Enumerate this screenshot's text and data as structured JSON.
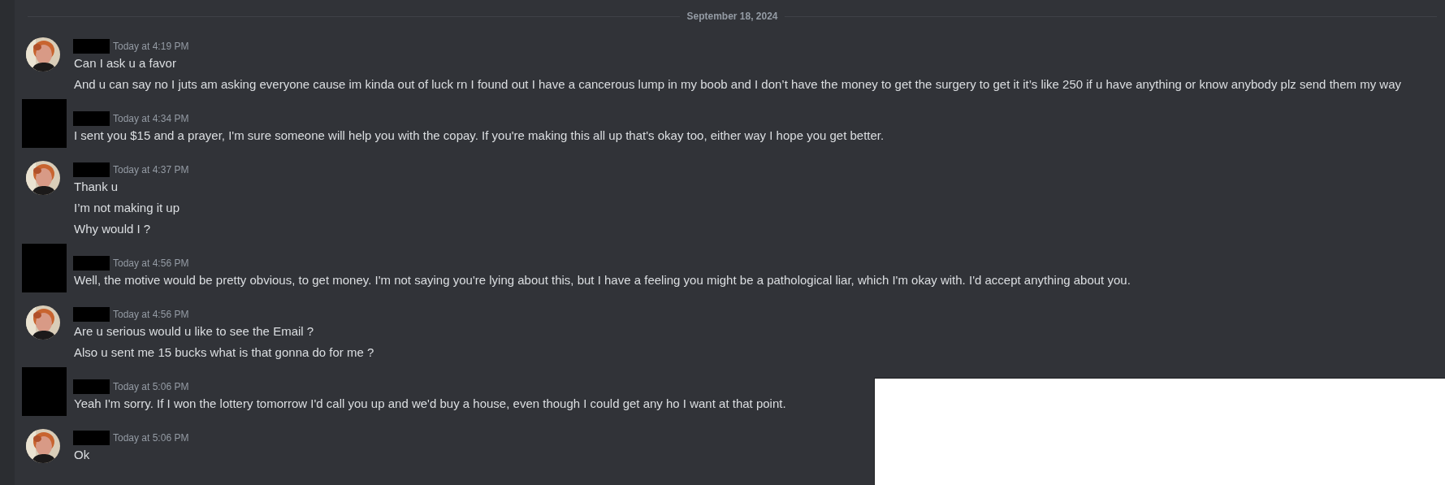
{
  "date_divider": "September 18, 2024",
  "messages": [
    {
      "time": "Today at 4:19 PM",
      "lines": [
        "Can I ask u a favor",
        "And u can say no I juts am asking everyone cause im kinda out of luck rn I found out I have a cancerous lump in my boob  and I don’t have the money to get the surgery to get it it’s like 250 if u have anything or know anybody plz send them my way"
      ]
    },
    {
      "kind": "redacted",
      "time": "Today at 4:34 PM",
      "lines": [
        "I sent you $15 and a prayer, I'm sure someone will help you with the copay. If you're making this all up that's okay too, either way I hope you get better."
      ]
    },
    {
      "time": "Today at 4:37 PM",
      "lines": [
        "Thank u",
        "I’m not making  it up",
        "Why would I ?"
      ]
    },
    {
      "kind": "redacted",
      "time": "Today at 4:56 PM",
      "lines": [
        "Well, the motive would be pretty obvious, to get money. I'm not saying you're lying about this, but I have a feeling you might be a pathological liar, which I'm okay with. I'd accept anything about you."
      ]
    },
    {
      "time": "Today at 4:56 PM",
      "lines": [
        "Are u serious would u like to see the Email ?",
        "Also u sent me 15 bucks what is that gonna do for me ?"
      ]
    },
    {
      "kind": "redacted",
      "time": "Today at 5:06 PM",
      "lines": [
        "Yeah I'm sorry. If I won the lottery tomorrow I'd call you up and we'd buy a house, even though I could get any ho I want at that point."
      ]
    },
    {
      "time": "Today at 5:06 PM",
      "lines": [
        "Ok"
      ]
    }
  ]
}
